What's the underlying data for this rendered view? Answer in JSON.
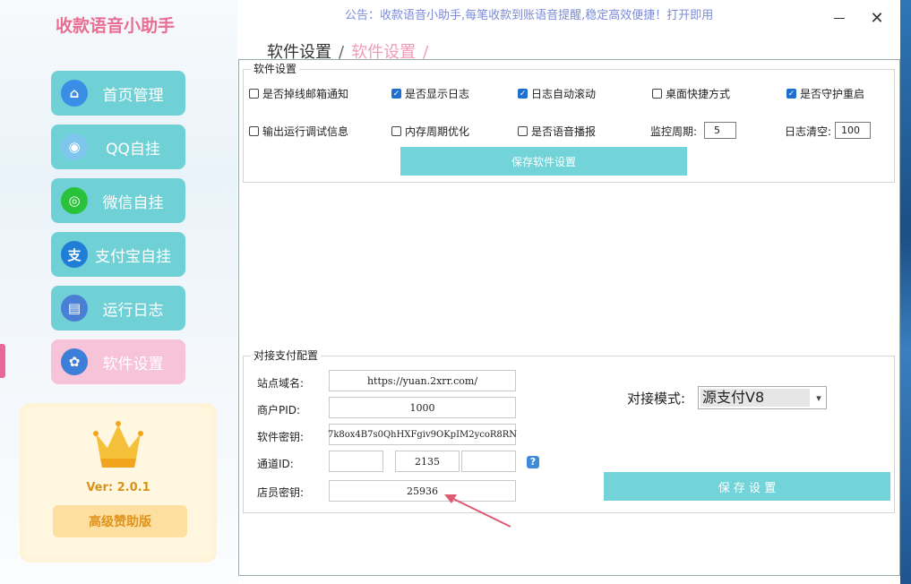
{
  "app": {
    "title": "收款语音小助手",
    "notice": "公告：收款语音小助手,每笔收款到账语音提醒,稳定高效便捷！打开即用",
    "close": "✕"
  },
  "nav": [
    {
      "label": "首页管理",
      "icon": "home-icon",
      "color": "#3a8ee6"
    },
    {
      "label": "QQ自挂",
      "icon": "qq-icon",
      "color": "#7fc6ee"
    },
    {
      "label": "微信自挂",
      "icon": "wechat-icon",
      "color": "#2bc23b"
    },
    {
      "label": "支付宝自挂",
      "icon": "alipay-icon",
      "color": "#1f7fd6"
    },
    {
      "label": "运行日志",
      "icon": "clipboard-icon",
      "color": "#4a7fd6"
    },
    {
      "label": "软件设置",
      "icon": "gear-icon",
      "color": "#3d7ed9"
    }
  ],
  "nav_icon_glyphs": [
    "⌂",
    "◉",
    "◎",
    "支",
    "▤",
    "✿"
  ],
  "vip": {
    "version": "Ver:  2.0.1",
    "button": "高级赞助版"
  },
  "breadcrumb": {
    "parent": "软件设置",
    "sep1": "/",
    "current": "软件设置",
    "sep2": "/"
  },
  "software_settings": {
    "title": "软件设置",
    "checkboxes": [
      {
        "label": "是否掉线邮箱通知",
        "checked": false
      },
      {
        "label": "是否显示日志",
        "checked": true
      },
      {
        "label": "日志自动滚动",
        "checked": true
      },
      {
        "label": "桌面快捷方式",
        "checked": false
      },
      {
        "label": "是否守护重启",
        "checked": true
      },
      {
        "label": "输出运行调试信息",
        "checked": false
      },
      {
        "label": "内存周期优化",
        "checked": false
      },
      {
        "label": "是否语音播报",
        "checked": false
      }
    ],
    "monitor_label": "监控周期:",
    "monitor_value": "5",
    "log_clear_label": "日志清空:",
    "log_clear_value": "100",
    "save_button": "保存软件设置"
  },
  "payment": {
    "title": "对接支付配置",
    "domain_label": "站点域名:",
    "domain_value": "https://yuan.2xrr.com/",
    "pid_label": "商户PID:",
    "pid_value": "1000",
    "key_label": "软件密钥:",
    "key_value": "7k8ox4B7s0QhHXFgiv9OKpIM2ycoR8RN",
    "channel_label": "通道ID:",
    "channel_values": [
      "",
      "2135",
      ""
    ],
    "help": "?",
    "clerk_label": "店员密钥:",
    "clerk_value": "25936",
    "mode_label": "对接模式:",
    "mode_value": "源支付V8",
    "save_button": "保 存 设 置"
  }
}
